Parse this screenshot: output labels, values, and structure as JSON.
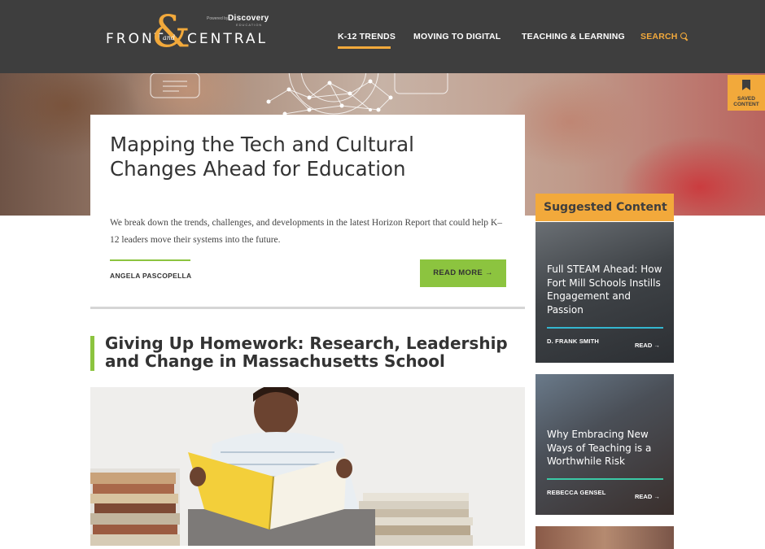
{
  "header": {
    "logo_front": "FRONT",
    "logo_amp": "&",
    "logo_and": "and",
    "logo_central": "CENTRAL",
    "powered_by": "Powered by",
    "discovery": "Discovery",
    "education": "EDUCATION",
    "nav": [
      {
        "label": "K-12 TRENDS",
        "active": true
      },
      {
        "label": "MOVING TO DIGITAL",
        "active": false
      },
      {
        "label": "TEACHING & LEARNING",
        "active": false
      },
      {
        "label": "SEARCH",
        "active": false
      }
    ]
  },
  "saved_tab": {
    "line1": "SAVED",
    "line2": "CONTENT",
    "icon": "bookmark-icon"
  },
  "feature": {
    "title": "Mapping the Tech and Cultural Changes Ahead for Education",
    "description": "We break down the trends, challenges, and developments in the latest Horizon Report that could help K–12 leaders move their systems into the future.",
    "author": "ANGELA PASCOPELLA",
    "read_more": "READ MORE →"
  },
  "article2": {
    "title": "Giving Up Homework: Research, Leadership and Change in Massachusetts School",
    "image": "boy-reading-book-with-stacks-of-books"
  },
  "sidebar": {
    "title": "Suggested Content",
    "cards": [
      {
        "title": "Full STEAM Ahead: How Fort Mill Schools Instills Engagement and Passion",
        "author": "D. FRANK SMITH",
        "read": "READ →",
        "accent": "#34b6cf"
      },
      {
        "title": "Why Embracing New Ways of Teaching is a Worthwhile Risk",
        "author": "REBECCA GENSEL",
        "read": "READ →",
        "accent": "#3bc9a6"
      }
    ]
  },
  "colors": {
    "orange": "#f2a93b",
    "green": "#8cc43f",
    "header": "#3e3e3e"
  }
}
